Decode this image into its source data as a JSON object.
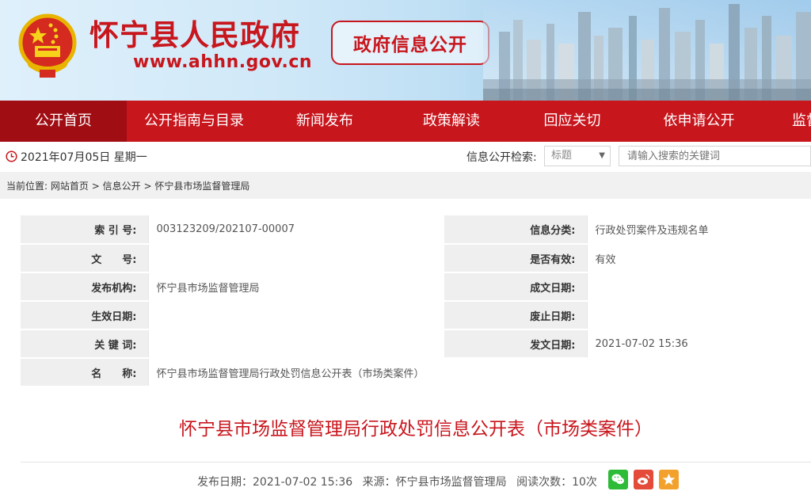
{
  "header": {
    "site_title": "怀宁县人民政府",
    "site_url": "www.ahhn.gov.cn",
    "section_badge": "政府信息公开"
  },
  "nav": {
    "items": [
      {
        "label": "公开首页",
        "active": true
      },
      {
        "label": "公开指南与目录"
      },
      {
        "label": "新闻发布"
      },
      {
        "label": "政策解读"
      },
      {
        "label": "回应关切"
      },
      {
        "label": "依申请公开"
      },
      {
        "label": "监督保障"
      }
    ]
  },
  "toolbar": {
    "date": "2021年07月05日 星期一",
    "search_label": "信息公开检索:",
    "search_select_value": "标题",
    "search_placeholder": "请输入搜索的关键词"
  },
  "breadcrumb": {
    "prefix": "当前位置:",
    "items": [
      "网站首页",
      "信息公开",
      "怀宁县市场监督管理局"
    ],
    "separator": ">"
  },
  "meta": {
    "rows": [
      {
        "k1": "索 引 号:",
        "v1": "003123209/202107-00007",
        "k2": "信息分类:",
        "v2": "行政处罚案件及违规名单"
      },
      {
        "k1": "文　　号:",
        "v1": "",
        "k2": "是否有效:",
        "v2": "有效"
      },
      {
        "k1": "发布机构:",
        "v1": "怀宁县市场监督管理局",
        "k2": "成文日期:",
        "v2": ""
      },
      {
        "k1": "生效日期:",
        "v1": "",
        "k2": "废止日期:",
        "v2": ""
      },
      {
        "k1": "关 键 词:",
        "v1": "",
        "k2": "发文日期:",
        "v2": "2021-07-02 15:36"
      }
    ],
    "name_label": "名　　称:",
    "name_value": "怀宁县市场监督管理局行政处罚信息公开表（市场类案件）"
  },
  "article": {
    "title": "怀宁县市场监督管理局行政处罚信息公开表（市场类案件）",
    "publish_date": "发布日期：2021-07-02 15:36",
    "source": "来源：怀宁县市场监督管理局",
    "views": "阅读次数：10次"
  },
  "colors": {
    "brand_red": "#c8161d",
    "nav_active": "#a00d13",
    "wechat": "#2dbb38",
    "weibo": "#e44b39",
    "favorite": "#f2a22c"
  },
  "icons": [
    "national-emblem-icon",
    "clock-icon",
    "chevron-down-icon",
    "wechat-icon",
    "weibo-icon",
    "star-icon"
  ]
}
